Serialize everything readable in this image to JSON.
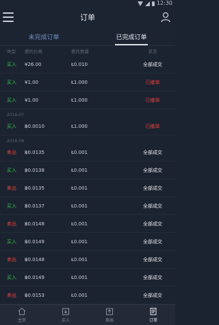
{
  "status_bar": {
    "time": "12:30"
  },
  "header": {
    "title": "订单"
  },
  "tabs": [
    {
      "label": "未完成订单",
      "active": false
    },
    {
      "label": "已完成订单",
      "active": true
    }
  ],
  "columns": {
    "type": "类型",
    "price": "委托价格",
    "qty": "委托数量",
    "status": "状态"
  },
  "rows_a": [
    {
      "type": "买入",
      "side": "buy",
      "price": "¥26.00",
      "qty": "Ł0.010",
      "status": "全部成交",
      "kind": "done"
    },
    {
      "type": "买入",
      "side": "buy",
      "price": "¥1.00",
      "qty": "Ł1.000",
      "status": "已撤单",
      "kind": "cancel"
    },
    {
      "type": "买入",
      "side": "buy",
      "price": "¥1.00",
      "qty": "Ł1.000",
      "status": "已撤单",
      "kind": "cancel"
    }
  ],
  "date_1": "2016-07",
  "rows_b": [
    {
      "type": "买入",
      "side": "buy",
      "price": "฿0.0010",
      "qty": "Ł1.000",
      "status": "已撤单",
      "kind": "cancel"
    }
  ],
  "date_2": "2016-08",
  "rows_c": [
    {
      "type": "卖出",
      "side": "sell",
      "price": "฿0.0135",
      "qty": "Ł0.001",
      "status": "全部成交",
      "kind": "done"
    },
    {
      "type": "买入",
      "side": "buy",
      "price": "฿0.0138",
      "qty": "Ł0.001",
      "status": "全部成交",
      "kind": "done"
    },
    {
      "type": "卖出",
      "side": "sell",
      "price": "฿0.0135",
      "qty": "Ł0.001",
      "status": "全部成交",
      "kind": "done"
    },
    {
      "type": "买入",
      "side": "buy",
      "price": "฿0.0137",
      "qty": "Ł0.001",
      "status": "全部成交",
      "kind": "done"
    },
    {
      "type": "卖出",
      "side": "sell",
      "price": "฿0.0148",
      "qty": "Ł0.001",
      "status": "全部成交",
      "kind": "done"
    },
    {
      "type": "买入",
      "side": "buy",
      "price": "฿0.0149",
      "qty": "Ł0.001",
      "status": "全部成交",
      "kind": "done"
    },
    {
      "type": "卖出",
      "side": "sell",
      "price": "฿0.0148",
      "qty": "Ł0.001",
      "status": "全部成交",
      "kind": "done"
    },
    {
      "type": "买入",
      "side": "buy",
      "price": "฿0.0149",
      "qty": "Ł0.001",
      "status": "全部成交",
      "kind": "done"
    },
    {
      "type": "卖出",
      "side": "sell",
      "price": "฿0.0153",
      "qty": "Ł0.001",
      "status": "全部成交",
      "kind": "done"
    }
  ],
  "nav": [
    {
      "label": "主页",
      "icon": "home-icon",
      "active": false
    },
    {
      "label": "买入",
      "icon": "buy-icon",
      "active": false
    },
    {
      "label": "卖出",
      "icon": "sell-icon",
      "active": false
    },
    {
      "label": "订单",
      "icon": "orders-icon",
      "active": true
    }
  ],
  "colors": {
    "buy": "#35c24a",
    "sell": "#e0433a",
    "background": "#1b2230",
    "active_text": "#e6e8ec"
  }
}
